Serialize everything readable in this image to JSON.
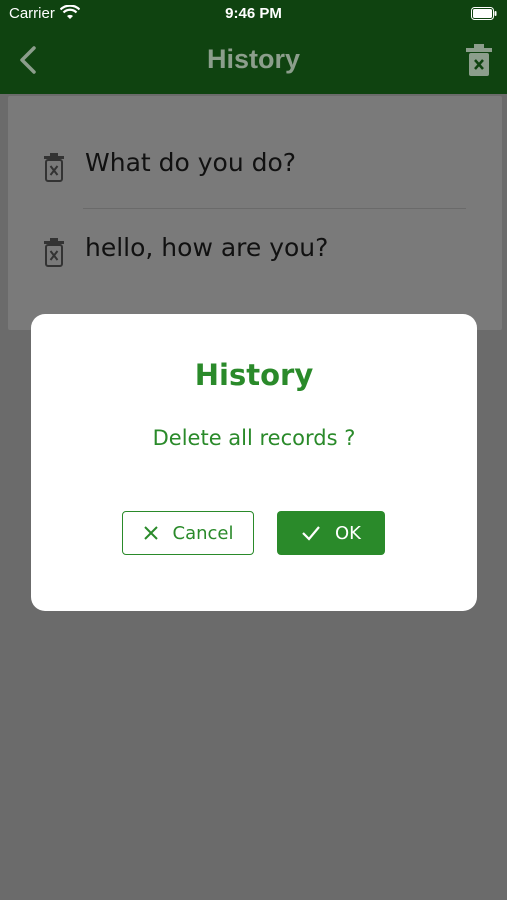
{
  "status_bar": {
    "carrier": "Carrier",
    "time": "9:46 PM"
  },
  "nav": {
    "title": "History"
  },
  "history": {
    "items": [
      {
        "text": "What do you do?"
      },
      {
        "text": "hello, how are you?"
      }
    ]
  },
  "dialog": {
    "title": "History",
    "message": "Delete all records ?",
    "cancel_label": "Cancel",
    "ok_label": "OK"
  },
  "colors": {
    "nav_background": "#0f4310",
    "accent_green": "#2a8a2a",
    "overlay_background": "#6b6b6b"
  },
  "icons": [
    "wifi-icon",
    "battery-icon",
    "back-chevron-icon",
    "trash-icon",
    "cancel-x-icon",
    "check-icon"
  ]
}
